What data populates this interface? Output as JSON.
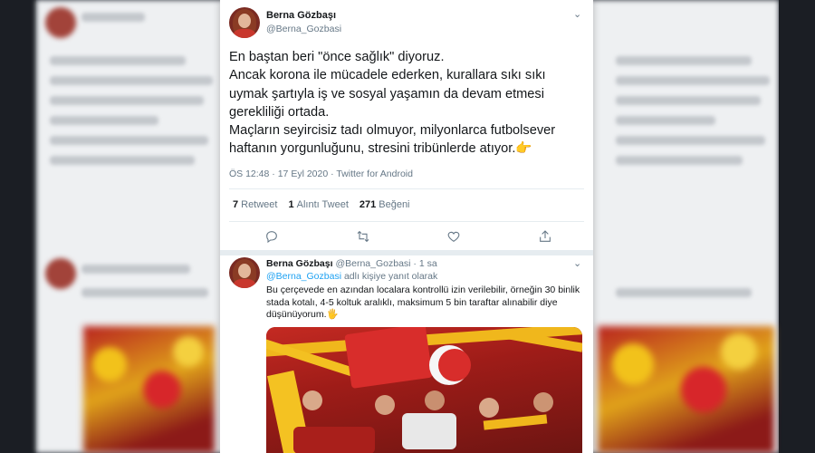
{
  "tweet": {
    "author_name": "Berna Gözbaşı",
    "author_handle": "@Berna_Gozbasi",
    "lines": [
      "En baştan beri \"önce sağlık\" diyoruz.",
      "Ancak korona ile mücadele ederken, kurallara sıkı sıkı",
      "uymak şartıyla iş ve sosyal yaşamın da devam etmesi",
      "gerekliliği ortada.",
      "Maçların seyircisiz tadı olmuyor, milyonlarca futbolsever",
      "haftanın yorgunluğunu, stresini tribünlerde atıyor."
    ],
    "emoji": "👉",
    "time": "ÖS 12:48",
    "date": "17 Eyl 2020",
    "source": "Twitter for Android",
    "retweets_count": "7",
    "retweets_label": "Retweet",
    "quotes_count": "1",
    "quotes_label": "Alıntı Tweet",
    "likes_count": "271",
    "likes_label": "Beğeni"
  },
  "actions": [
    "reply-icon",
    "retweet-icon",
    "like-icon",
    "share-icon"
  ],
  "reply": {
    "author_name": "Berna Gözbaşı",
    "author_handle": "@Berna_Gozbasi",
    "age": "1 sa",
    "reply_mention": "@Berna_Gozbasi",
    "reply_suffix": "adlı kişiye yanıt olarak",
    "lines": [
      "Bu çerçevede en azından localara kontrollü izin verilebilir, örneğin 30 binlik",
      "stada kotalı, 4-5 koltuk aralıklı, maksimum 5 bin taraftar alınabilir diye",
      "düşünüyorum."
    ],
    "emoji": "🖐"
  },
  "colors": {
    "accent": "#1da1f2",
    "muted": "#657786",
    "text": "#14171a",
    "divider": "#e6ecf0"
  }
}
